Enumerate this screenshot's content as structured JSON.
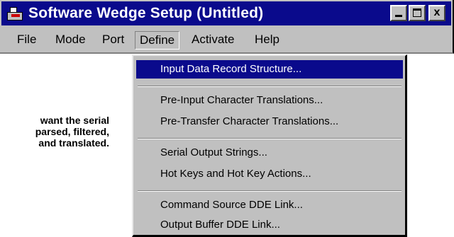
{
  "window": {
    "title": "Software Wedge Setup (Untitled)",
    "controls": [
      "minimize",
      "maximize",
      "close"
    ],
    "close_glyph": "x"
  },
  "menubar": {
    "items": [
      {
        "label": "File"
      },
      {
        "label": "Mode"
      },
      {
        "label": "Port"
      },
      {
        "label": "Define",
        "open": true
      },
      {
        "label": "Activate"
      },
      {
        "label": "Help"
      }
    ]
  },
  "dropdown": {
    "items": [
      {
        "label": "Input Data Record Structure...",
        "selected": true
      },
      {
        "label": "Pre-Input Character Translations..."
      },
      {
        "label": "Pre-Transfer Character Translations..."
      },
      {
        "label": "Serial Output Strings..."
      },
      {
        "label": "Hot Keys and Hot Key Actions..."
      },
      {
        "label": "Command Source DDE Link..."
      },
      {
        "label": "Output Buffer DDE Link..."
      }
    ]
  },
  "side_text": {
    "line1": "want the serial",
    "line2": "parsed, filtered,",
    "line3": "and translated."
  },
  "colors": {
    "titlebar": "#0a0a8c",
    "face": "#c0c0c0",
    "highlight": "#0a0a8c"
  },
  "icons": {
    "app": "wedge-app-icon"
  }
}
